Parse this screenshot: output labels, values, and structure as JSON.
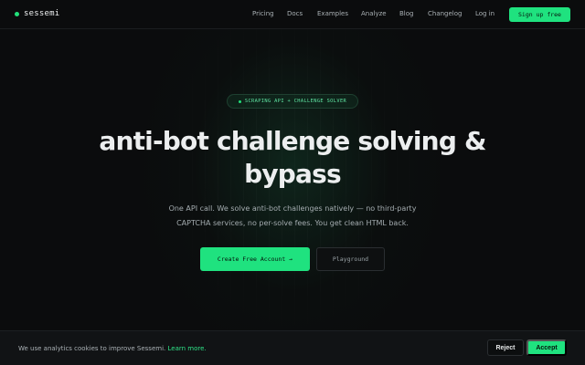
{
  "brand": {
    "name": "sessemi",
    "accent": "#1fe27f"
  },
  "nav": {
    "links": [
      "Pricing",
      "Docs",
      "Examples",
      "Analyze",
      "Blog",
      "Changelog",
      "Log in"
    ],
    "signup_label": "Sign up free"
  },
  "hero": {
    "badge": "SCRAPING API + CHALLENGE SOLVER",
    "headline_line1": "anti-bot challenge solving &",
    "headline_line2": "bypass",
    "sub_line1": "One API call. We solve anti-bot challenges natively — no third-party",
    "sub_line2": "CAPTCHA services, no per-solve fees. You get clean HTML back.",
    "cta_label": "Create Free Account →",
    "playground_label": "Playground"
  },
  "cookie": {
    "text": "We use analytics cookies to improve Sessemi.",
    "link": "Learn more.",
    "reject_label": "Reject",
    "accept_label": "Accept"
  }
}
